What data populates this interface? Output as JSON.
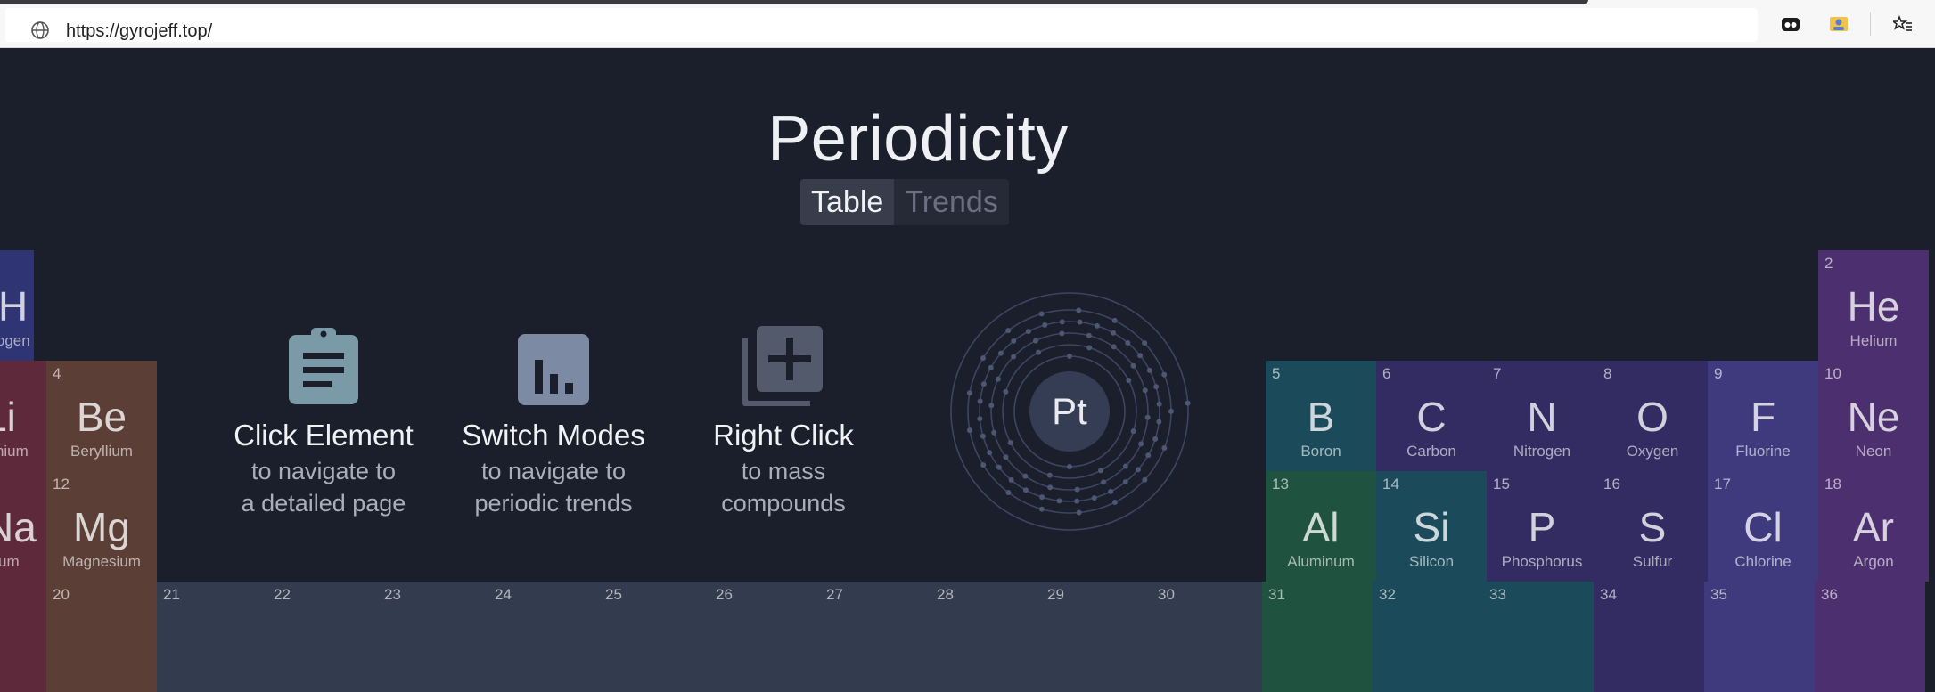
{
  "browser": {
    "url": "https://gyrojeff.top/"
  },
  "app": {
    "title": "Periodicity",
    "modes": [
      {
        "label": "Table"
      },
      {
        "label": "Trends"
      }
    ]
  },
  "hints": [
    {
      "heading": "Click Element",
      "line1": "to navigate to",
      "line2": "a detailed page",
      "icon": "clipboard-icon"
    },
    {
      "heading": "Switch Modes",
      "line1": "to navigate to",
      "line2": "periodic trends",
      "icon": "bar-chart-icon"
    },
    {
      "heading": "Right Click",
      "line1": "to mass",
      "line2": "compounds",
      "icon": "add-to-collection-icon"
    }
  ],
  "atom": {
    "symbol": "Pt"
  },
  "elements": {
    "h": {
      "symbol": "H",
      "name": "Hydrogen"
    },
    "li": {
      "symbol": "Li",
      "name": "Lithium"
    },
    "na": {
      "symbol": "Na",
      "name": "Sodium"
    },
    "be": {
      "number": "4",
      "symbol": "Be",
      "name": "Beryllium"
    },
    "mg": {
      "number": "12",
      "symbol": "Mg",
      "name": "Magnesium"
    },
    "ca": {
      "number": "20"
    },
    "b": {
      "number": "5",
      "symbol": "B",
      "name": "Boron"
    },
    "c": {
      "number": "6",
      "symbol": "C",
      "name": "Carbon"
    },
    "n": {
      "number": "7",
      "symbol": "N",
      "name": "Nitrogen"
    },
    "o": {
      "number": "8",
      "symbol": "O",
      "name": "Oxygen"
    },
    "f": {
      "number": "9",
      "symbol": "F",
      "name": "Fluorine"
    },
    "ne": {
      "number": "10",
      "symbol": "Ne",
      "name": "Neon"
    },
    "he": {
      "number": "2",
      "symbol": "He",
      "name": "Helium"
    },
    "al": {
      "number": "13",
      "symbol": "Al",
      "name": "Aluminum"
    },
    "si": {
      "number": "14",
      "symbol": "Si",
      "name": "Silicon"
    },
    "p": {
      "number": "15",
      "symbol": "P",
      "name": "Phosphorus"
    },
    "s": {
      "number": "16",
      "symbol": "S",
      "name": "Sulfur"
    },
    "cl": {
      "number": "17",
      "symbol": "Cl",
      "name": "Chlorine"
    },
    "ar": {
      "number": "18",
      "symbol": "Ar",
      "name": "Argon"
    },
    "row4": [
      "21",
      "22",
      "23",
      "24",
      "25",
      "26",
      "27",
      "28",
      "29",
      "30",
      "31",
      "32",
      "33",
      "34",
      "35",
      "36"
    ]
  },
  "colors": {
    "background": "#1b1f2b",
    "alkali": "#5e2a3b",
    "alkaline_earth": "#5b3f36",
    "transition": "#333c4e",
    "post_transition": "#1f5340",
    "metalloid": "#1b4b5a",
    "nonmetal": "#322c63",
    "halogen": "#3f3a7e",
    "noble_gas": "#4c2f6f",
    "hydrogen": "#2f3474"
  }
}
